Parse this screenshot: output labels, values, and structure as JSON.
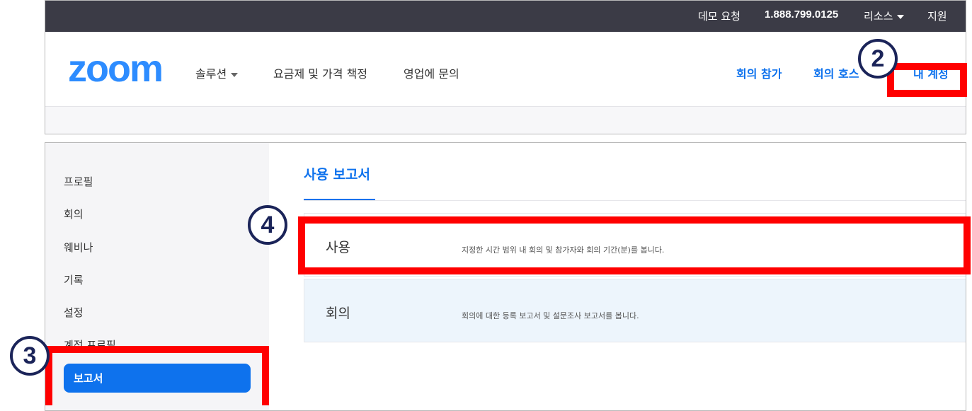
{
  "topbar": {
    "demo": "데모 요청",
    "phone": "1.888.799.0125",
    "resources": "리소스",
    "support": "지원"
  },
  "navbar": {
    "logo": "zoom",
    "solutions": "솔루션",
    "pricing": "요금제 및 가격 책정",
    "contact_sales": "영업에 문의",
    "join": "회의 참가",
    "host": "회의 호스",
    "my_account": "내 계정"
  },
  "sidebar": {
    "items": [
      "프로필",
      "회의",
      "웨비나",
      "기록",
      "설정",
      "계정 프로필"
    ],
    "active": "보고서"
  },
  "content": {
    "title": "사용 보고서",
    "reports": [
      {
        "name": "사용",
        "description": "지정한 시간 범위 내 회의 및 참가자와 회의 기간(분)를 봅니다."
      },
      {
        "name": "회의",
        "description": "회의에 대한 등록 보고서 및 설문조사 보고서를 봅니다."
      }
    ]
  },
  "annotations": {
    "step2": "2",
    "step3": "3",
    "step4": "4",
    "highlight_color": "#ff0000",
    "badge_color": "#1b2459"
  },
  "colors": {
    "accent": "#0e72ed",
    "logo": "#2d8cff",
    "topbar": "#3b3b46"
  }
}
